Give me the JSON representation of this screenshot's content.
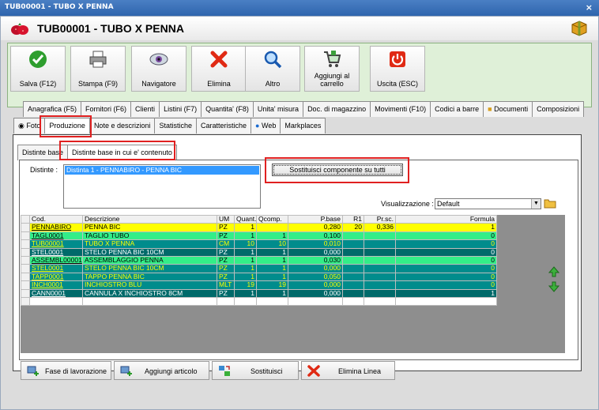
{
  "window": {
    "title": "TUB00001 - TUBO X PENNA",
    "close": "×"
  },
  "header": {
    "title": "TUB00001 - TUBO X PENNA"
  },
  "toolbar": [
    {
      "name": "salva",
      "label": "Salva (F12)",
      "icon": "check-icon"
    },
    {
      "name": "stampa",
      "label": "Stampa (F9)",
      "icon": "printer-icon"
    },
    {
      "name": "navigatore",
      "label": "Navigatore",
      "icon": "eye-icon"
    },
    {
      "name": "elimina",
      "label": "Elimina",
      "icon": "x-icon"
    },
    {
      "name": "altro",
      "label": "Altro",
      "icon": "magnifier-icon"
    },
    {
      "name": "carrello",
      "label": "Aggiungi al carrello",
      "icon": "cart-icon"
    },
    {
      "name": "uscita",
      "label": "Uscita (ESC)",
      "icon": "power-icon"
    }
  ],
  "tabs_row1": [
    "Anagrafica (F5)",
    "Fornitori (F6)",
    "Clienti",
    "Listini (F7)",
    "Quantita' (F8)",
    "Unita' misura",
    "Doc. di magazzino",
    "Movimenti (F10)",
    "Codici a barre",
    "Documenti",
    "Composizioni"
  ],
  "tabs_row2": [
    "Foto",
    "Produzione",
    "Note e descrizioni",
    "Statistiche",
    "Caratteristiche",
    "Web",
    "Markplaces"
  ],
  "subtabs": [
    "Distinte base",
    "Distinte base in cui e' contenuto"
  ],
  "distinte": {
    "label": "Distinte :",
    "selected": "Distinta 1 - PENNABIRO - PENNA BIC"
  },
  "sostituisci_tutti": "Sostituisci componente su tutti",
  "visualizzazione": {
    "label": "Visualizzazione :",
    "value": "Default"
  },
  "grid": {
    "columns": [
      "Cod.",
      "Descrizione",
      "UM",
      "Quant.",
      "Qcomp.",
      "P.base",
      "R1",
      "Pr.sc.",
      "Formula"
    ],
    "rows": [
      {
        "cod": "PENNABIRO",
        "desc": "PENNA BIC",
        "um": "PZ",
        "quant": "1",
        "qcomp": "",
        "pbase": "0,280",
        "r1": "20",
        "prsc": "0,336",
        "formula": "1",
        "bg": "#ffff00",
        "fg": "#000000"
      },
      {
        "cod": "TAGL0001",
        "desc": "TAGLIO TUBO",
        "um": "PZ",
        "quant": "1",
        "qcomp": "1",
        "pbase": "0,100",
        "r1": "",
        "prsc": "",
        "formula": "0",
        "bg": "#33ee88",
        "fg": "#000000"
      },
      {
        "cod": "TUB00001",
        "desc": "TUBO X PENNA",
        "um": "CM",
        "quant": "10",
        "qcomp": "10",
        "pbase": "0,010",
        "r1": "",
        "prsc": "",
        "formula": "0",
        "bg": "#008c8c",
        "fg": "#ffff00"
      },
      {
        "cod": "STEL0001",
        "desc": "STELO PENNA BIC 10CM",
        "um": "PZ",
        "quant": "1",
        "qcomp": "1",
        "pbase": "0,000",
        "r1": "",
        "prsc": "",
        "formula": "0",
        "bg": "#006a6a",
        "fg": "#ffffff"
      },
      {
        "cod": "ASSEMBL00001",
        "desc": "ASSEMBLAGGIO PENNA",
        "um": "PZ",
        "quant": "1",
        "qcomp": "1",
        "pbase": "0,030",
        "r1": "",
        "prsc": "",
        "formula": "0",
        "bg": "#33ee88",
        "fg": "#000000"
      },
      {
        "cod": "STEL0001",
        "desc": "STELO PENNA BIC 10CM",
        "um": "PZ",
        "quant": "1",
        "qcomp": "1",
        "pbase": "0,000",
        "r1": "",
        "prsc": "",
        "formula": "0",
        "bg": "#008c8c",
        "fg": "#ffff00"
      },
      {
        "cod": "TAPP0001",
        "desc": "TAPPO PENNA BIC",
        "um": "PZ",
        "quant": "1",
        "qcomp": "1",
        "pbase": "0,050",
        "r1": "",
        "prsc": "",
        "formula": "0",
        "bg": "#008c8c",
        "fg": "#ffff00"
      },
      {
        "cod": "INCH0001",
        "desc": "INCHIOSTRO BLU",
        "um": "MLT",
        "quant": "19",
        "qcomp": "19",
        "pbase": "0,000",
        "r1": "",
        "prsc": "",
        "formula": "0",
        "bg": "#008c8c",
        "fg": "#ffff00"
      },
      {
        "cod": "CANN0001",
        "desc": "CANNULA X INCHIOSTRO 8CM",
        "um": "PZ",
        "quant": "1",
        "qcomp": "1",
        "pbase": "0,000",
        "r1": "",
        "prsc": "",
        "formula": "1",
        "bg": "#006a6a",
        "fg": "#ffffff"
      }
    ]
  },
  "bottom_buttons": [
    {
      "name": "fase",
      "label": "Fase di lavorazione",
      "icon": "add-phase-icon"
    },
    {
      "name": "aggiungi",
      "label": "Aggiungi articolo",
      "icon": "add-item-icon"
    },
    {
      "name": "sostituisci",
      "label": "Sostituisci",
      "icon": "swap-icon"
    },
    {
      "name": "elimina-linea",
      "label": "Elimina Linea",
      "icon": "delete-icon"
    }
  ]
}
